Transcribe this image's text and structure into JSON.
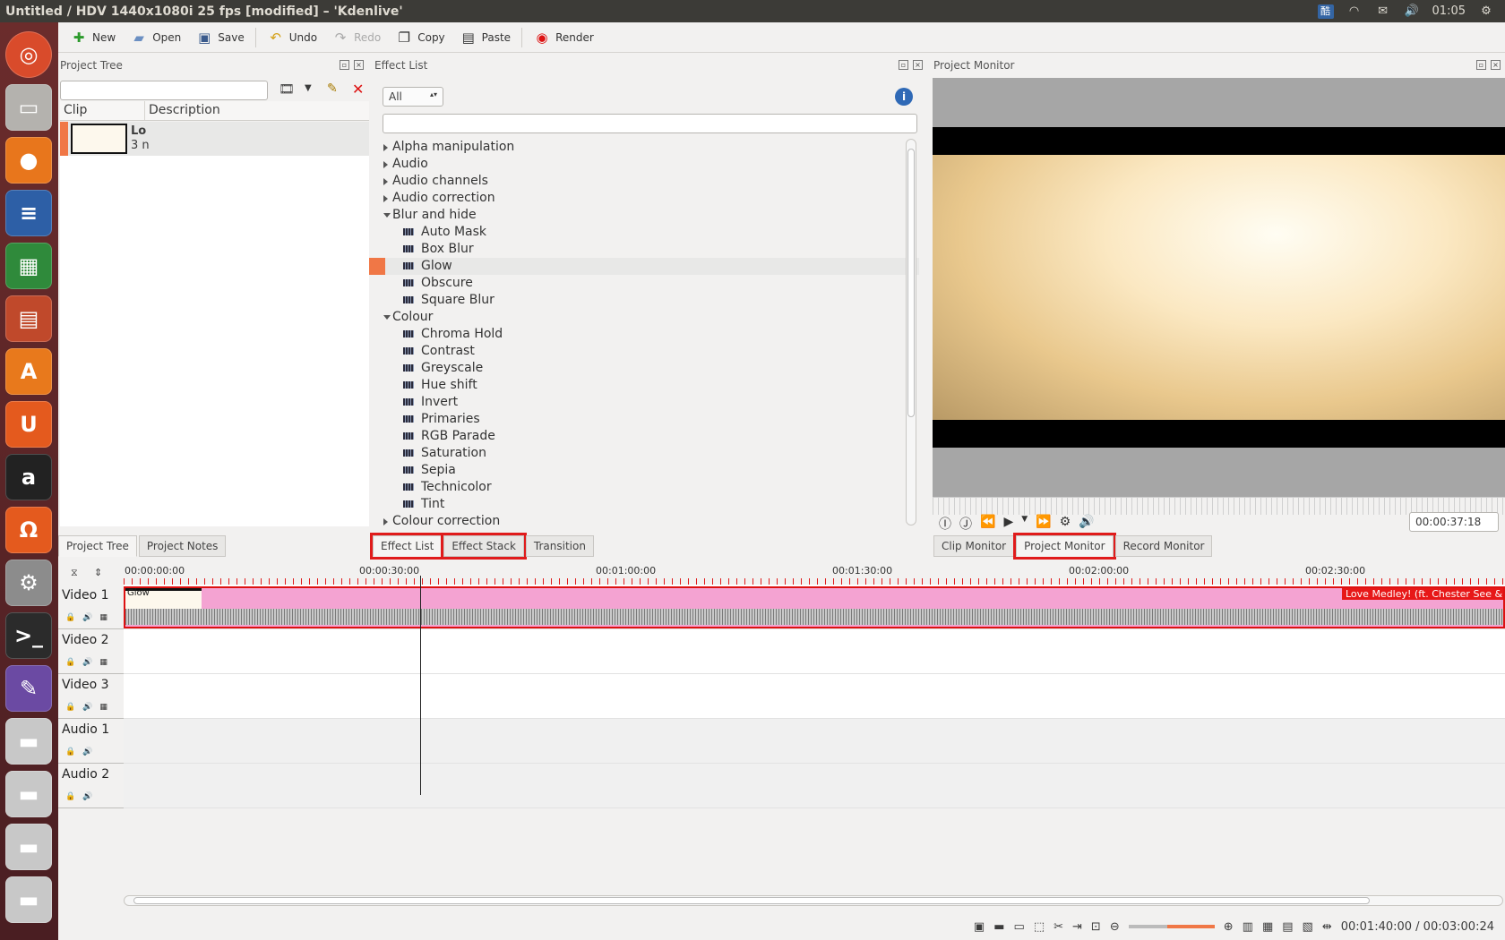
{
  "window": {
    "title": "Untitled / HDV 1440x1080i 25 fps [modified] – 'Kdenlive'"
  },
  "tray": {
    "ime": "酷",
    "clock": "01:05"
  },
  "launcher": {
    "items": [
      "ubuntu-icon",
      "files-icon",
      "firefox-icon",
      "writer-icon",
      "calc-icon",
      "impress-icon",
      "software-center-icon",
      "ubuntu-one-icon",
      "amazon-icon",
      "ubuntu-one-music-icon",
      "settings-icon",
      "terminal-icon",
      "kdenlive-icon",
      "drive-icon",
      "drive-icon",
      "drive-icon",
      "drive-icon",
      "trash-icon"
    ]
  },
  "toolbar": {
    "new": "New",
    "open": "Open",
    "save": "Save",
    "undo": "Undo",
    "redo": "Redo",
    "copy": "Copy",
    "paste": "Paste",
    "render": "Render"
  },
  "project_tree": {
    "title": "Project Tree",
    "columns": [
      "Clip",
      "Description"
    ],
    "clip": {
      "name": "Lo",
      "duration": "3 n"
    },
    "tabs": [
      "Project Tree",
      "Project Notes"
    ]
  },
  "effect_list": {
    "title": "Effect List",
    "filter": "All",
    "items": [
      {
        "type": "cat",
        "label": "Alpha manipulation",
        "open": false
      },
      {
        "type": "cat",
        "label": "Audio",
        "open": false
      },
      {
        "type": "cat",
        "label": "Audio channels",
        "open": false
      },
      {
        "type": "cat",
        "label": "Audio correction",
        "open": false
      },
      {
        "type": "cat",
        "label": "Blur and hide",
        "open": true
      },
      {
        "type": "eff",
        "label": "Auto Mask"
      },
      {
        "type": "eff",
        "label": "Box Blur"
      },
      {
        "type": "eff",
        "label": "Glow",
        "selected": true
      },
      {
        "type": "eff",
        "label": "Obscure"
      },
      {
        "type": "eff",
        "label": "Square Blur"
      },
      {
        "type": "cat",
        "label": "Colour",
        "open": true
      },
      {
        "type": "eff",
        "label": "Chroma Hold"
      },
      {
        "type": "eff",
        "label": "Contrast"
      },
      {
        "type": "eff",
        "label": "Greyscale"
      },
      {
        "type": "eff",
        "label": "Hue shift"
      },
      {
        "type": "eff",
        "label": "Invert"
      },
      {
        "type": "eff",
        "label": "Primaries"
      },
      {
        "type": "eff",
        "label": "RGB Parade"
      },
      {
        "type": "eff",
        "label": "Saturation"
      },
      {
        "type": "eff",
        "label": "Sepia"
      },
      {
        "type": "eff",
        "label": "Technicolor"
      },
      {
        "type": "eff",
        "label": "Tint"
      },
      {
        "type": "cat",
        "label": "Colour correction",
        "open": false
      }
    ],
    "tabs": [
      "Effect List",
      "Effect Stack",
      "Transition"
    ]
  },
  "monitor": {
    "title": "Project Monitor",
    "timecode": "00:00:37:18",
    "tabs": [
      "Clip Monitor",
      "Project Monitor",
      "Record Monitor"
    ]
  },
  "timeline": {
    "ruler": [
      "00:00:00:00",
      "00:00:30:00",
      "00:01:00:00",
      "00:01:30:00",
      "00:02:00:00",
      "00:02:30:00"
    ],
    "tracks": [
      "Video 1",
      "Video 2",
      "Video 3",
      "Audio 1",
      "Audio 2"
    ],
    "clip": {
      "effect": "Glow",
      "title": "Love Medley! (ft. Chester See & K"
    }
  },
  "status": {
    "position": "00:01:40:00 / 00:03:00:24"
  },
  "colors": {
    "accent": "#f07746",
    "highlight": "#e01b1b",
    "clip": "#f4a3d2"
  }
}
